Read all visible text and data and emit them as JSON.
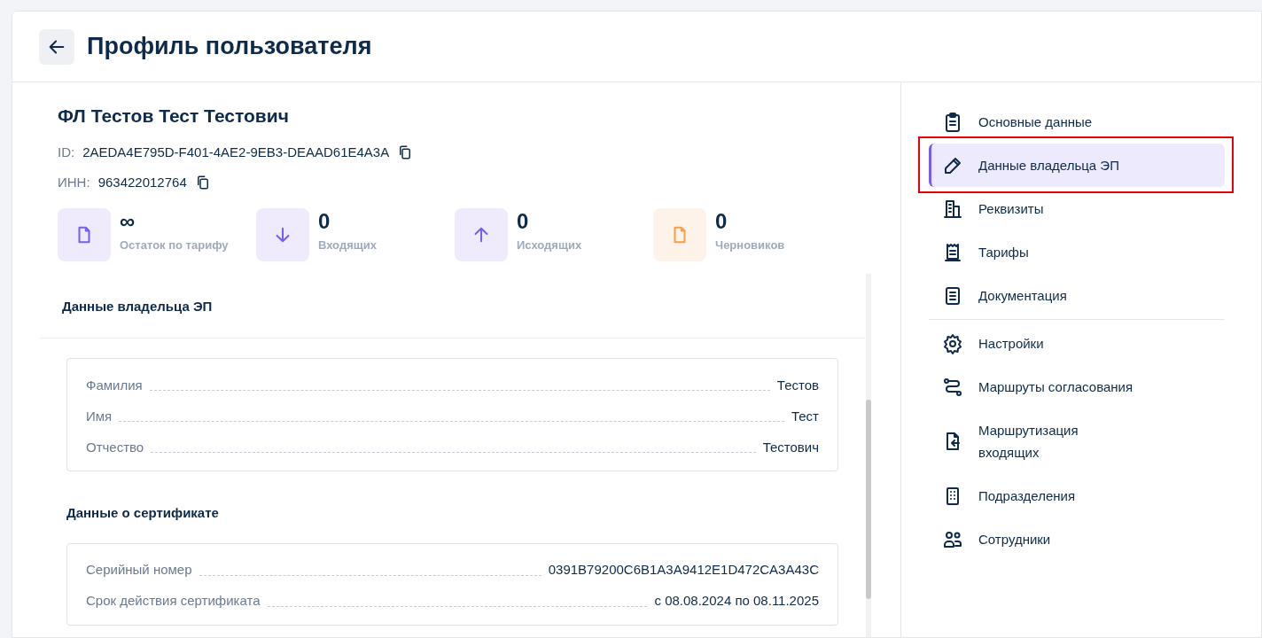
{
  "header": {
    "title": "Профиль пользователя"
  },
  "profile": {
    "name": "ФЛ Тестов Тест Тестович",
    "ids": [
      {
        "label": "ID:",
        "value": "2AEDA4E795D-F401-4AE2-9EB3-DEAAD61E4A3A"
      },
      {
        "label": "ИНН:",
        "value": "963422012764"
      }
    ]
  },
  "stats": [
    {
      "kind": "file",
      "color": "#7b5cf0",
      "value": "∞",
      "label": "Остаток по тарифу"
    },
    {
      "kind": "down",
      "color": "#7b5cf0",
      "value": "0",
      "label": "Входящих"
    },
    {
      "kind": "up",
      "color": "#7b5cf0",
      "value": "0",
      "label": "Исходящих"
    },
    {
      "kind": "file",
      "color": "#f5a04a",
      "value": "0",
      "label": "Черновиков"
    }
  ],
  "sections": [
    {
      "title": "Данные владельца ЭП",
      "divider": true,
      "rows": [
        {
          "label": "Фамилия",
          "value": "Тестов"
        },
        {
          "label": "Имя",
          "value": "Тест"
        },
        {
          "label": "Отчество",
          "value": "Тестович"
        }
      ]
    },
    {
      "title": "Данные о сертификате",
      "divider": false,
      "rows": [
        {
          "label": "Серийный номер",
          "value": "0391B79200C6B1A3A9412E1D472CA3A43C"
        },
        {
          "label": "Срок действия сертификата",
          "value": "с 08.08.2024 по 08.11.2025"
        }
      ]
    }
  ],
  "sidebar": {
    "groups": [
      {
        "items": [
          {
            "label": "Основные данные",
            "selected": false,
            "highlighted": false
          },
          {
            "label": "Данные владельца ЭП",
            "selected": true,
            "highlighted": true
          },
          {
            "label": "Реквизиты",
            "selected": false,
            "highlighted": false
          },
          {
            "label": "Тарифы",
            "selected": false,
            "highlighted": false
          },
          {
            "label": "Документация",
            "selected": false,
            "highlighted": false
          }
        ]
      },
      {
        "items": [
          {
            "label": "Настройки",
            "selected": false,
            "highlighted": false
          },
          {
            "label": "Маршруты согласования",
            "selected": false,
            "highlighted": false
          },
          {
            "label": "Маршрутизация входящих",
            "selected": false,
            "highlighted": false
          },
          {
            "label": "Подразделения",
            "selected": false,
            "highlighted": false
          },
          {
            "label": "Сотрудники",
            "selected": false,
            "highlighted": false
          }
        ]
      }
    ]
  }
}
